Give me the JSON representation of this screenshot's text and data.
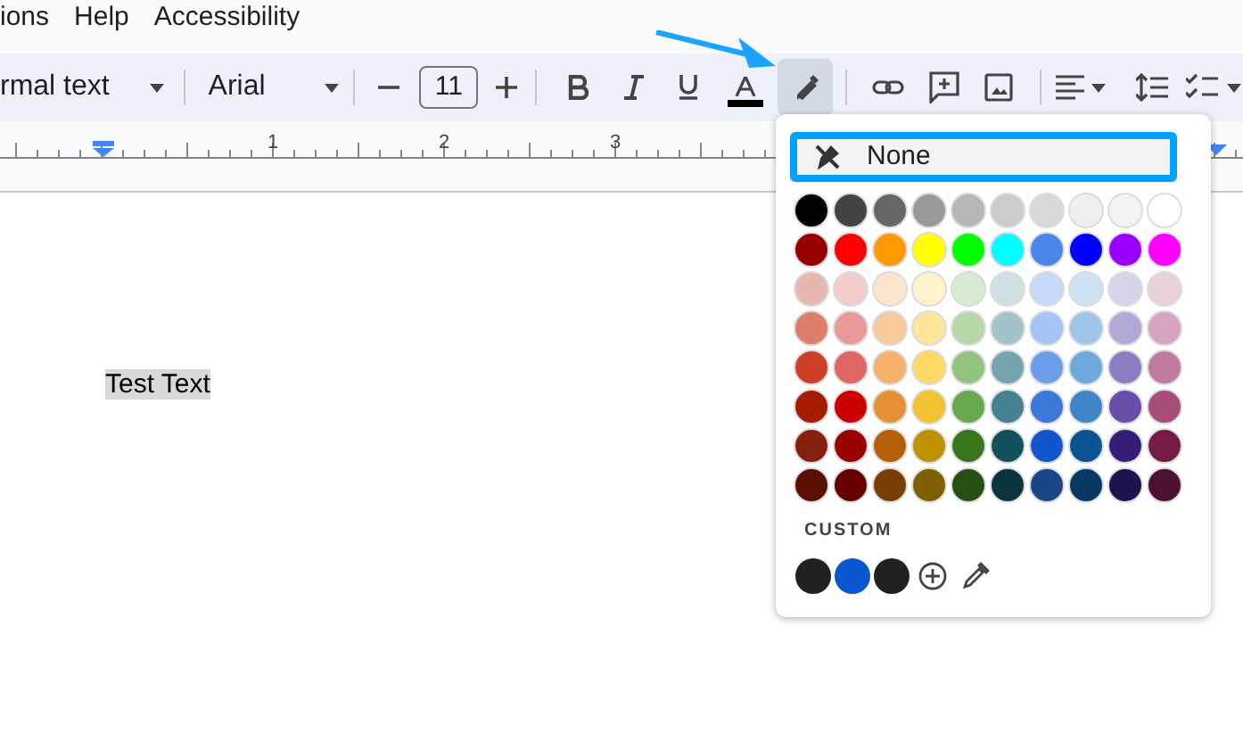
{
  "menu": [
    "ions",
    "Help",
    "Accessibility"
  ],
  "toolbar": {
    "style": "rmal text",
    "font": "Arial",
    "size": "11",
    "text_color_bar": {
      "color": "#000000"
    },
    "highlight_open": true
  },
  "ruler": {
    "labels": [
      "1",
      "2",
      "3"
    ]
  },
  "document": {
    "text": "Test Text",
    "highlight": {
      "color": "#d9d9d9"
    }
  },
  "highlight_menu": {
    "none_label": "None",
    "none_focused": true,
    "palette": [
      [
        {
          "color": "#000000"
        },
        {
          "color": "#434343"
        },
        {
          "color": "#666666"
        },
        {
          "color": "#999999"
        },
        {
          "color": "#b7b7b7"
        },
        {
          "color": "#cccccc"
        },
        {
          "color": "#d9d9d9"
        },
        {
          "color": "#efefef"
        },
        {
          "color": "#f3f3f3"
        },
        {
          "color": "#ffffff"
        }
      ],
      [
        {
          "color": "#980000"
        },
        {
          "color": "#ff0000"
        },
        {
          "color": "#ff9900"
        },
        {
          "color": "#ffff00"
        },
        {
          "color": "#00ff00"
        },
        {
          "color": "#00ffff"
        },
        {
          "color": "#4a86e8"
        },
        {
          "color": "#0000ff"
        },
        {
          "color": "#9900ff"
        },
        {
          "color": "#ff00ff"
        }
      ],
      [
        {
          "color": "#e6b8af"
        },
        {
          "color": "#f4cccc"
        },
        {
          "color": "#fce5cd"
        },
        {
          "color": "#fff2cc"
        },
        {
          "color": "#d9ead3"
        },
        {
          "color": "#d0e0e3"
        },
        {
          "color": "#c9daf8"
        },
        {
          "color": "#cfe2f3"
        },
        {
          "color": "#d9d2e9"
        },
        {
          "color": "#ead1dc"
        }
      ],
      [
        {
          "color": "#dd7e6b"
        },
        {
          "color": "#ea9999"
        },
        {
          "color": "#f9cb9c"
        },
        {
          "color": "#ffe599"
        },
        {
          "color": "#b6d7a8"
        },
        {
          "color": "#a2c4c9"
        },
        {
          "color": "#a4c2f4"
        },
        {
          "color": "#9fc5e8"
        },
        {
          "color": "#b4a7d6"
        },
        {
          "color": "#d5a6bd"
        }
      ],
      [
        {
          "color": "#cc4125"
        },
        {
          "color": "#e06666"
        },
        {
          "color": "#f6b26b"
        },
        {
          "color": "#ffd966"
        },
        {
          "color": "#93c47d"
        },
        {
          "color": "#76a5af"
        },
        {
          "color": "#6d9eeb"
        },
        {
          "color": "#6fa8dc"
        },
        {
          "color": "#8e7cc3"
        },
        {
          "color": "#c27ba0"
        }
      ],
      [
        {
          "color": "#a61c00"
        },
        {
          "color": "#cc0000"
        },
        {
          "color": "#e69138"
        },
        {
          "color": "#f1c232"
        },
        {
          "color": "#6aa84f"
        },
        {
          "color": "#45818e"
        },
        {
          "color": "#3c78d8"
        },
        {
          "color": "#3d85c6"
        },
        {
          "color": "#674ea7"
        },
        {
          "color": "#a64d79"
        }
      ],
      [
        {
          "color": "#85200c"
        },
        {
          "color": "#990000"
        },
        {
          "color": "#b45f06"
        },
        {
          "color": "#bf9000"
        },
        {
          "color": "#38761d"
        },
        {
          "color": "#134f5c"
        },
        {
          "color": "#1155cc"
        },
        {
          "color": "#0b5394"
        },
        {
          "color": "#351c75"
        },
        {
          "color": "#741b47"
        }
      ],
      [
        {
          "color": "#5b0f00"
        },
        {
          "color": "#660000"
        },
        {
          "color": "#783f04"
        },
        {
          "color": "#7f6000"
        },
        {
          "color": "#274e13"
        },
        {
          "color": "#0c343d"
        },
        {
          "color": "#1c4587"
        },
        {
          "color": "#073763"
        },
        {
          "color": "#20124d"
        },
        {
          "color": "#4c1130"
        }
      ]
    ],
    "custom_label": "CUSTOM",
    "custom_colors": [
      {
        "color": "#212121"
      },
      {
        "color": "#0b57d0"
      },
      {
        "color": "#212121"
      }
    ]
  }
}
